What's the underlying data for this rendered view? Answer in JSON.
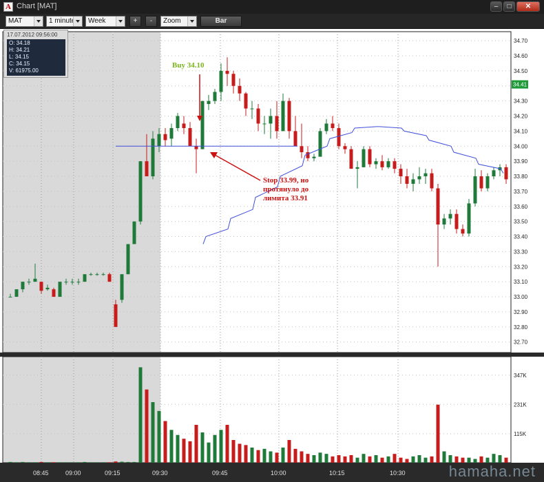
{
  "window": {
    "title": "Chart [MAT]"
  },
  "toolbar": {
    "symbol": "MAT",
    "interval": "1 minute",
    "range": "Week",
    "zoom_in_label": "+",
    "zoom_out_label": "-",
    "zoom": "Zoom",
    "style_label": "Bar"
  },
  "info_panel": {
    "datetime": "17.07.2012 09:56:00",
    "open": "O: 34.18",
    "high": "H: 34.21",
    "low": "L: 34.15",
    "close": "C: 34.15",
    "volume": "V: 61975.00"
  },
  "annotations": {
    "buy_label": "Buy 34.10",
    "stop_line1": "Stop 33.99, но",
    "stop_line2": "протянуло до",
    "stop_line3": "лимита 33.91",
    "buy_color": "#7ab51d",
    "stop_color": "#cc1111"
  },
  "watermark": "hamaha.net",
  "colors": {
    "up": "#1f7a3a",
    "down": "#c71c1c",
    "ma": "#3f4fd9",
    "premarket": "#d9d9d9",
    "price_badge": "#1e9a38"
  },
  "chart_data": {
    "type": "candlestick",
    "x_ticks": [
      "08:45",
      "09:00",
      "09:15",
      "09:30",
      "09:45",
      "10:00",
      "10:15",
      "10:30"
    ],
    "price_axis": {
      "ticks": [
        "34.70",
        "34.60",
        "34.50",
        "34.40",
        "34.30",
        "34.20",
        "34.10",
        "34.00",
        "33.90",
        "33.80",
        "33.70",
        "33.60",
        "33.50",
        "33.40",
        "33.30",
        "33.20",
        "33.10",
        "33.00",
        "32.90",
        "32.80",
        "32.70"
      ],
      "range": [
        32.63,
        34.76
      ],
      "last_price": "34.41"
    },
    "volume_axis": {
      "ticks": [
        "347K",
        "231K",
        "115K"
      ],
      "range": [
        0,
        420000
      ]
    },
    "horizontal_line": 34.0,
    "session_open_time": "09:30",
    "candles": [
      [
        33.0,
        33.02,
        33.0,
        33.0
      ],
      [
        33.0,
        33.05,
        33.0,
        33.05
      ],
      [
        33.05,
        33.1,
        33.03,
        33.1
      ],
      [
        33.1,
        33.12,
        33.08,
        33.1
      ],
      [
        33.1,
        33.22,
        33.1,
        33.12
      ],
      [
        33.1,
        33.1,
        33.02,
        33.04
      ],
      [
        33.05,
        33.08,
        33.04,
        33.06
      ],
      [
        33.05,
        33.06,
        33.0,
        33.0
      ],
      [
        33.0,
        33.1,
        33.0,
        33.1
      ],
      [
        33.1,
        33.12,
        33.08,
        33.1
      ],
      [
        33.1,
        33.12,
        33.08,
        33.1
      ],
      [
        33.1,
        33.12,
        33.08,
        33.1
      ],
      [
        33.1,
        33.15,
        33.1,
        33.15
      ],
      [
        33.15,
        33.16,
        33.14,
        33.15
      ],
      [
        33.15,
        33.16,
        33.14,
        33.15
      ],
      [
        33.15,
        33.16,
        33.14,
        33.15
      ],
      [
        33.15,
        33.16,
        33.1,
        33.1
      ],
      [
        32.95,
        32.98,
        32.8,
        32.8
      ],
      [
        32.98,
        33.15,
        32.96,
        33.15
      ],
      [
        33.15,
        33.35,
        33.15,
        33.35
      ],
      [
        33.35,
        33.5,
        33.35,
        33.5
      ],
      [
        33.5,
        33.9,
        33.48,
        33.9
      ],
      [
        33.9,
        34.08,
        33.8,
        33.8
      ],
      [
        33.8,
        34.1,
        33.78,
        34.05
      ],
      [
        34.0,
        34.12,
        33.96,
        34.08
      ],
      [
        34.08,
        34.12,
        34.0,
        34.04
      ],
      [
        34.05,
        34.15,
        34.0,
        34.12
      ],
      [
        34.12,
        34.22,
        34.1,
        34.2
      ],
      [
        34.15,
        34.2,
        34.08,
        34.12
      ],
      [
        34.12,
        34.16,
        34.0,
        34.0
      ],
      [
        34.0,
        34.05,
        33.82,
        33.98
      ],
      [
        33.98,
        34.3,
        33.98,
        34.3
      ],
      [
        34.28,
        34.34,
        34.24,
        34.3
      ],
      [
        34.3,
        34.38,
        34.28,
        34.36
      ],
      [
        34.36,
        34.55,
        34.3,
        34.5
      ],
      [
        34.5,
        34.59,
        34.4,
        34.48
      ],
      [
        34.48,
        34.5,
        34.35,
        34.4
      ],
      [
        34.4,
        34.45,
        34.3,
        34.35
      ],
      [
        34.35,
        34.36,
        34.2,
        34.25
      ],
      [
        34.25,
        34.3,
        34.18,
        34.25
      ],
      [
        34.25,
        34.28,
        34.1,
        34.15
      ],
      [
        34.15,
        34.2,
        34.08,
        34.15
      ],
      [
        34.15,
        34.25,
        34.05,
        34.2
      ],
      [
        34.2,
        34.3,
        34.05,
        34.1
      ],
      [
        34.1,
        34.35,
        34.1,
        34.3
      ],
      [
        34.3,
        34.32,
        34.05,
        34.1
      ],
      [
        34.1,
        34.2,
        34.0,
        34.0
      ],
      [
        34.0,
        34.15,
        33.92,
        33.96
      ],
      [
        33.96,
        34.0,
        33.9,
        33.92
      ],
      [
        33.92,
        33.95,
        33.9,
        33.93
      ],
      [
        33.93,
        34.12,
        33.93,
        34.1
      ],
      [
        34.1,
        34.18,
        34.08,
        34.15
      ],
      [
        34.15,
        34.2,
        34.1,
        34.12
      ],
      [
        34.12,
        34.15,
        33.98,
        34.0
      ],
      [
        34.0,
        34.02,
        33.95,
        33.98
      ],
      [
        33.98,
        34.0,
        33.85,
        33.85
      ],
      [
        33.85,
        33.9,
        33.72,
        33.86
      ],
      [
        33.86,
        34.0,
        33.86,
        33.98
      ],
      [
        33.98,
        34.0,
        33.86,
        33.88
      ],
      [
        33.88,
        33.92,
        33.85,
        33.9
      ],
      [
        33.9,
        33.94,
        33.84,
        33.86
      ],
      [
        33.86,
        33.92,
        33.85,
        33.9
      ],
      [
        33.9,
        33.92,
        33.82,
        33.85
      ],
      [
        33.85,
        33.88,
        33.75,
        33.8
      ],
      [
        33.8,
        33.85,
        33.72,
        33.75
      ],
      [
        33.75,
        33.82,
        33.7,
        33.78
      ],
      [
        33.78,
        33.86,
        33.75,
        33.8
      ],
      [
        33.8,
        33.85,
        33.75,
        33.82
      ],
      [
        33.82,
        33.85,
        33.7,
        33.72
      ],
      [
        33.72,
        33.75,
        33.2,
        33.48
      ],
      [
        33.48,
        33.55,
        33.45,
        33.52
      ],
      [
        33.52,
        33.58,
        33.48,
        33.55
      ],
      [
        33.55,
        33.58,
        33.42,
        33.45
      ],
      [
        33.45,
        33.48,
        33.4,
        33.42
      ],
      [
        33.42,
        33.65,
        33.4,
        33.62
      ],
      [
        33.62,
        33.85,
        33.6,
        33.8
      ],
      [
        33.8,
        33.84,
        33.7,
        33.72
      ],
      [
        33.72,
        33.82,
        33.7,
        33.8
      ],
      [
        33.8,
        33.86,
        33.78,
        33.84
      ],
      [
        33.84,
        33.88,
        33.8,
        33.86
      ],
      [
        33.86,
        33.88,
        33.75,
        33.78
      ]
    ],
    "volume_k": [
      3,
      2,
      3,
      2,
      2,
      3,
      2,
      2,
      2,
      2,
      2,
      2,
      3,
      2,
      2,
      2,
      2,
      5,
      4,
      3,
      3,
      378,
      290,
      240,
      205,
      165,
      130,
      110,
      95,
      85,
      150,
      120,
      80,
      110,
      130,
      150,
      90,
      75,
      70,
      60,
      50,
      55,
      45,
      40,
      60,
      90,
      55,
      45,
      35,
      30,
      40,
      35,
      25,
      30,
      25,
      30,
      20,
      35,
      25,
      30,
      20,
      25,
      35,
      20,
      15,
      25,
      30,
      20,
      25,
      230,
      45,
      30,
      25,
      20,
      20,
      15,
      25,
      20,
      35,
      30,
      20
    ],
    "moving_average": [
      [
        33.35,
        33.4
      ],
      [
        33.45,
        33.52
      ],
      [
        33.58,
        33.66
      ],
      [
        33.73,
        33.8
      ],
      [
        33.87,
        33.94
      ],
      [
        34.0,
        34.05
      ],
      [
        34.09,
        34.12
      ],
      [
        34.13,
        34.13
      ],
      [
        34.12,
        34.1
      ],
      [
        34.07,
        34.04
      ],
      [
        34.0,
        33.96
      ],
      [
        33.92,
        33.88
      ],
      [
        33.85,
        33.82
      ]
    ]
  }
}
